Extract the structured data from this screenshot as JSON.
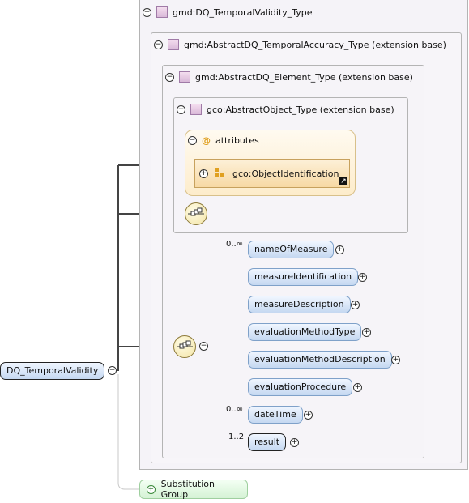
{
  "root_element": {
    "label": "DQ_TemporalValidity"
  },
  "type_boxes": [
    {
      "label": "gmd:DQ_TemporalValidity_Type"
    },
    {
      "label": "gmd:AbstractDQ_TemporalAccuracy_Type (extension base)"
    },
    {
      "label": "gmd:AbstractDQ_Element_Type (extension base)"
    },
    {
      "label": "gco:AbstractObject_Type (extension base)"
    }
  ],
  "attributes": {
    "label": "attributes",
    "at_symbol": "@",
    "item": {
      "label": "gco:ObjectIdentification"
    }
  },
  "sequence_elements": [
    {
      "label": "nameOfMeasure",
      "occurrence": "0..∞"
    },
    {
      "label": "measureIdentification",
      "occurrence": ""
    },
    {
      "label": "measureDescription",
      "occurrence": ""
    },
    {
      "label": "evaluationMethodType",
      "occurrence": ""
    },
    {
      "label": "evaluationMethodDescription",
      "occurrence": ""
    },
    {
      "label": "evaluationProcedure",
      "occurrence": ""
    },
    {
      "label": "dateTime",
      "occurrence": "0..∞"
    },
    {
      "label": "result",
      "occurrence": "1..2"
    }
  ],
  "substitution_group": {
    "label": "Substitution Group"
  },
  "glyphs": {
    "collapse": "−",
    "expand": "+"
  },
  "colors": {
    "element_fill": "#c5d8f1",
    "attribute_fill": "#fdeccb",
    "type_icon": "#d9b8d8",
    "substitution_fill": "#d5f2d5"
  }
}
